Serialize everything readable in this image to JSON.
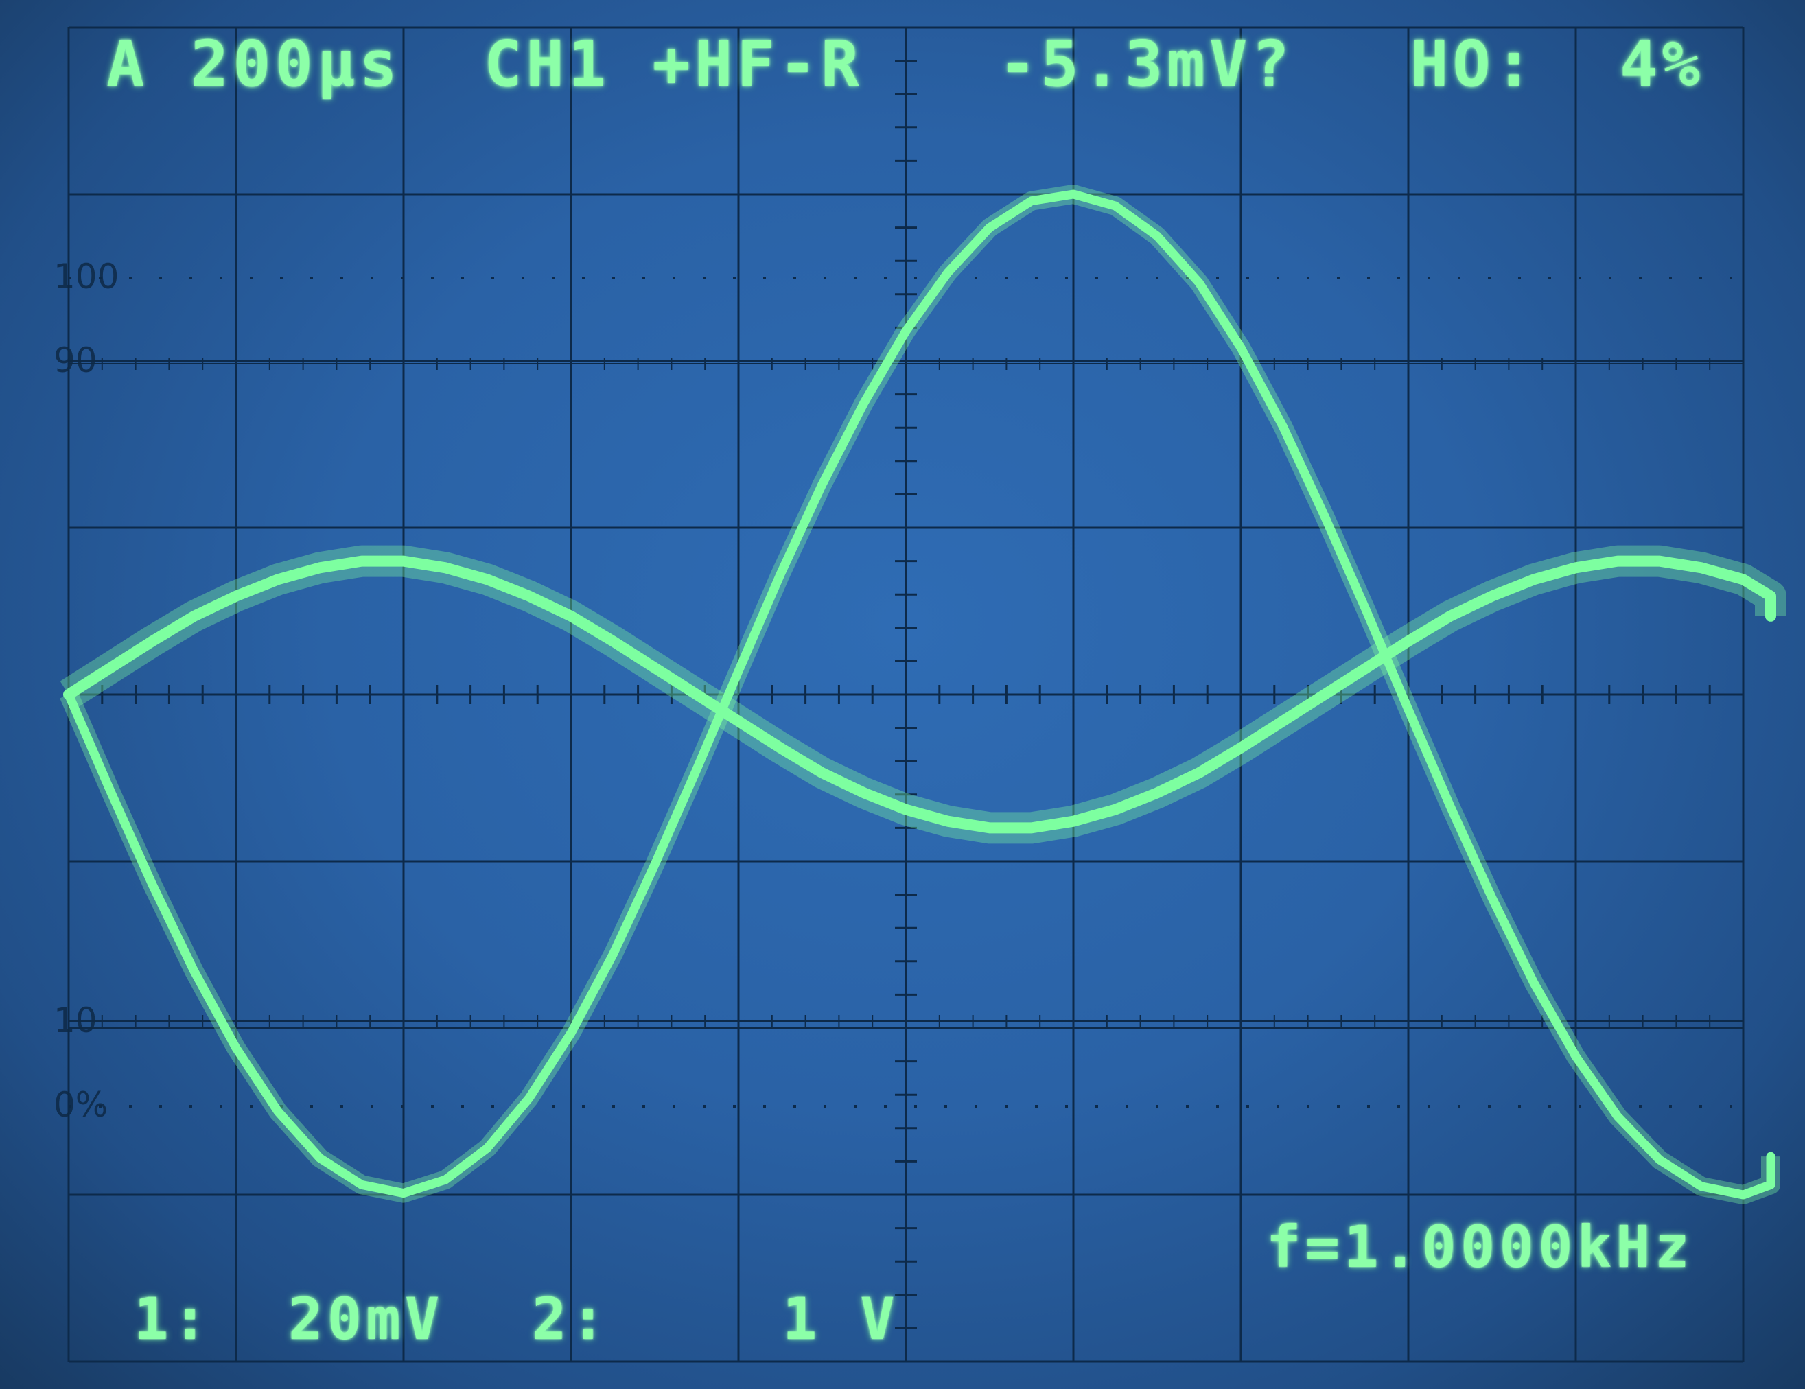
{
  "readouts": {
    "timebase": "A 200µs",
    "trigger_source": "CH1 +HF-R",
    "trigger_level": "-5.3mV?",
    "holdoff_label": "HO:",
    "holdoff_value": "4%",
    "frequency": "f=1.0000kHz",
    "ch1_label": "1:",
    "ch1_scale": "20mV",
    "ch2_label": "2:",
    "ch2_scale": "1 V"
  },
  "graticule_labels": {
    "l100": "100",
    "l90": "90",
    "l10": "10",
    "l0": "0%"
  },
  "colors": {
    "trace": "#7dffa0",
    "graticule": "#0d2a4a",
    "screen": "#2a62a6"
  },
  "chart_data": {
    "type": "line",
    "title": "",
    "xlabel": "",
    "ylabel": "",
    "x_unit": "µs",
    "y_unit": "div",
    "xlim": [
      0,
      2000
    ],
    "ylim": [
      -4,
      4
    ],
    "grid": true,
    "series": [
      {
        "name": "CH1",
        "x": [
          0,
          50,
          100,
          150,
          200,
          250,
          300,
          350,
          400,
          450,
          500,
          550,
          600,
          650,
          700,
          750,
          800,
          850,
          900,
          950,
          1000,
          1050,
          1100,
          1150,
          1200,
          1250,
          1300,
          1350,
          1400,
          1450,
          1500,
          1550,
          1600,
          1650,
          1700,
          1750,
          1800,
          1850,
          1900,
          1950,
          2000,
          2050,
          2100
        ],
        "values": [
          0.0,
          0.16,
          0.32,
          0.47,
          0.59,
          0.69,
          0.76,
          0.8,
          0.8,
          0.76,
          0.69,
          0.59,
          0.47,
          0.32,
          0.16,
          0.0,
          -0.16,
          -0.32,
          -0.47,
          -0.59,
          -0.69,
          -0.76,
          -0.8,
          -0.8,
          -0.76,
          -0.69,
          -0.59,
          -0.47,
          -0.32,
          -0.16,
          0.0,
          0.16,
          0.32,
          0.47,
          0.59,
          0.69,
          0.76,
          0.8,
          0.8,
          0.76,
          0.69,
          0.59,
          0.47
        ]
      },
      {
        "name": "CH2",
        "x": [
          0,
          50,
          100,
          150,
          200,
          250,
          300,
          350,
          400,
          450,
          500,
          550,
          600,
          650,
          700,
          750,
          800,
          850,
          900,
          950,
          1000,
          1050,
          1100,
          1150,
          1200,
          1250,
          1300,
          1350,
          1400,
          1450,
          1500,
          1550,
          1600,
          1650,
          1700,
          1750,
          1800,
          1850,
          1900,
          1950,
          2000,
          2050,
          2100
        ],
        "values": [
          0.0,
          -0.58,
          -1.14,
          -1.66,
          -2.12,
          -2.5,
          -2.78,
          -2.94,
          -2.99,
          -2.91,
          -2.72,
          -2.42,
          -2.03,
          -1.56,
          -1.02,
          -0.45,
          0.14,
          0.72,
          1.26,
          1.75,
          2.18,
          2.53,
          2.8,
          2.96,
          3.0,
          2.93,
          2.75,
          2.47,
          2.08,
          1.61,
          1.07,
          0.5,
          -0.09,
          -0.67,
          -1.22,
          -1.73,
          -2.17,
          -2.53,
          -2.79,
          -2.95,
          -3.0,
          -2.94,
          -2.77
        ]
      }
    ]
  }
}
